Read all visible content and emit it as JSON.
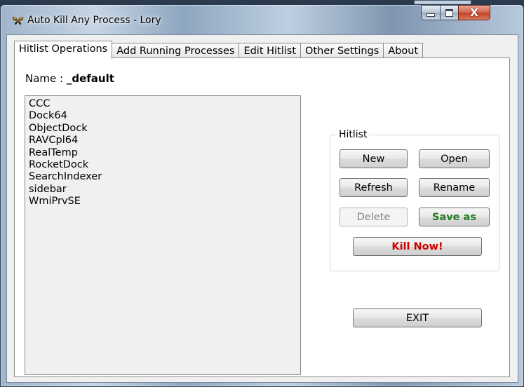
{
  "window": {
    "title": "Auto Kill Any Process - Lory",
    "close_glyph": "X"
  },
  "tabs": [
    {
      "label": "Hitlist Operations",
      "active": true
    },
    {
      "label": "Add Running Processes",
      "active": false
    },
    {
      "label": "Edit Hitlist",
      "active": false
    },
    {
      "label": "Other Settings",
      "active": false
    },
    {
      "label": "About",
      "active": false
    }
  ],
  "hitlist_name": {
    "label": "Name :",
    "value": "_default"
  },
  "processes": [
    "CCC",
    "Dock64",
    "ObjectDock",
    "RAVCpl64",
    "RealTemp",
    "RocketDock",
    "SearchIndexer",
    "sidebar",
    "WmiPrvSE"
  ],
  "hitlist_group": {
    "label": "Hitlist",
    "new": "New",
    "open": "Open",
    "refresh": "Refresh",
    "rename": "Rename",
    "delete": "Delete",
    "save_as": "Save as",
    "kill_now": "Kill Now!"
  },
  "exit_label": "EXIT",
  "colors": {
    "save_as_text": "#1f7a1f",
    "kill_now_text": "#cc0000",
    "close_button": "#c2462d"
  },
  "icons": {
    "app": "butterfly-icon",
    "minimize": "minimize-icon",
    "maximize": "maximize-icon",
    "close": "close-icon"
  }
}
